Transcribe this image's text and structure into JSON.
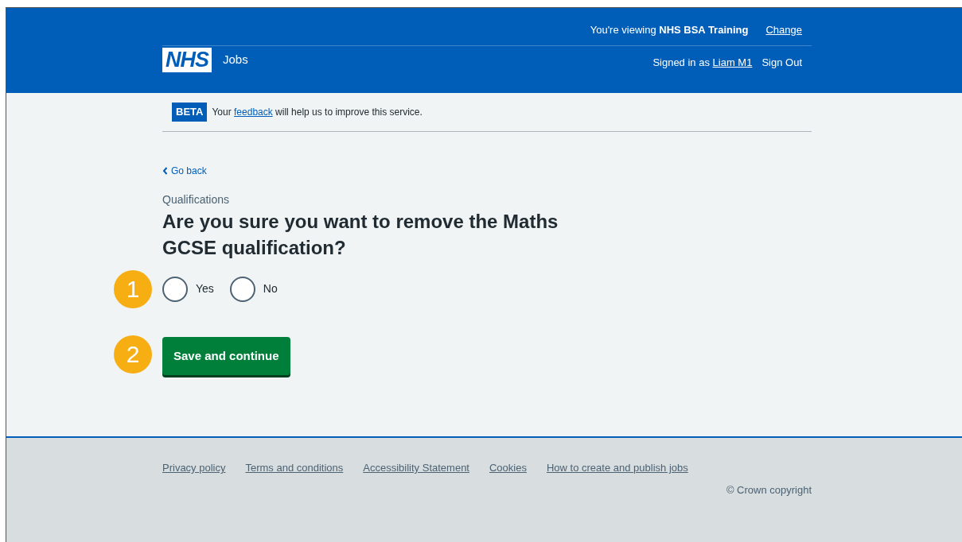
{
  "header": {
    "logo": "NHS",
    "service_name": "Jobs",
    "viewing": "You're viewing **NHS BSA Training**",
    "change_link": "Change",
    "signed_in_prefix": "Signed in as",
    "user_link": "Liam M1",
    "sign_out": "Sign Out"
  },
  "phase_banner": {
    "tag": "BETA",
    "before": "Your",
    "link": "feedback",
    "after": "will help us to improve this service."
  },
  "back_link": "Go back",
  "caption": "Qualifications",
  "heading": "Are you sure you want to remove the Maths GCSE qualification?",
  "callouts": [
    "1",
    "2"
  ],
  "radios": [
    {
      "label": "Yes",
      "selected": false
    },
    {
      "label": "No",
      "selected": false
    }
  ],
  "submit_button": "Save and continue",
  "footer": {
    "links": [
      "Privacy policy",
      "Terms and conditions",
      "Accessibility Statement",
      "Cookies",
      "How to create and publish jobs"
    ],
    "copyright": "© Crown copyright"
  }
}
